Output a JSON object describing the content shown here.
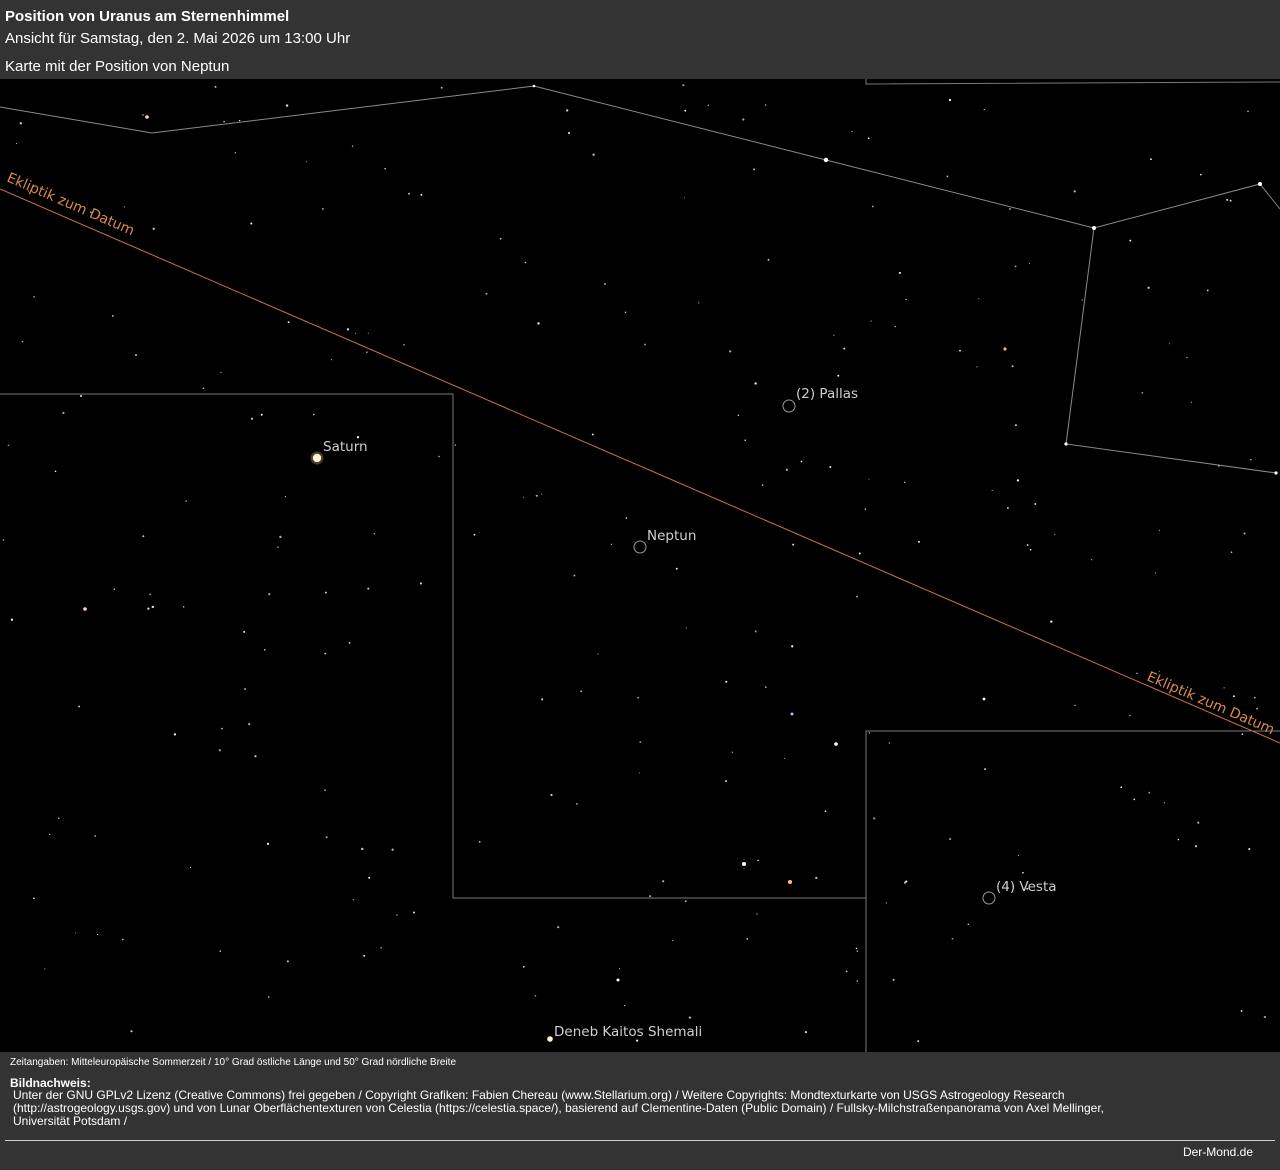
{
  "header": {
    "title": "Position von Uranus am Sternenhimmel",
    "subtitle": "Ansicht für Samstag, den 2. Mai 2026 um 13:00 Uhr",
    "map_link": "Karte mit der Position von Neptun"
  },
  "sky": {
    "labels": {
      "ecliptic_left": "Ekliptik zum Datum",
      "ecliptic_right": "Ekliptik zum Datum",
      "saturn": "Saturn",
      "pallas": "(2) Pallas",
      "neptun": "Neptun",
      "vesta": "(4) Vesta",
      "deneb": "Deneb Kaitos Shemali"
    },
    "colors": {
      "background": "#000000",
      "ecliptic": "#c8743a",
      "constellation_lines": "#8a8a8a",
      "boundary_lines": "#8a8a8a",
      "saturn": "#fff4d6"
    }
  },
  "footer": {
    "timezone": "Zeitangaben: Mitteleuropäische Sommerzeit / 10° Grad östliche Länge und 50° Grad nördliche Breite",
    "credits_title": "Bildnachweis:",
    "credits_text": "Unter der GNU GPLv2 Lizenz (Creative Commons) frei gegeben / Copyright Grafiken: Fabien Chereau (www.Stellarium.org) / Weitere Copyrights: Mondtexturkarte von USGS Astrogeology Research (http://astrogeology.usgs.gov) und von Lunar Oberflächentexturen von Celestia (https://celestia.space/), basierend auf Clementine-Daten (Public Domain) / Fullsky-Milchstraßenpanorama von Axel Mellinger, Universität Potsdam /",
    "site": "Der-Mond.de"
  }
}
